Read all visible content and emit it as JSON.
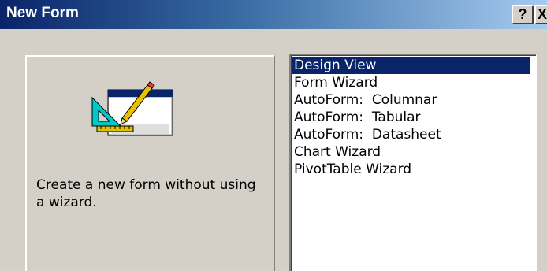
{
  "window": {
    "title": "New Form",
    "help_label": "?",
    "close_label": "X"
  },
  "preview": {
    "icon": "form-design-icon",
    "description": "Create a new form without using a wizard."
  },
  "list": {
    "items": [
      {
        "label": "Design View",
        "selected": true
      },
      {
        "label": "Form Wizard",
        "selected": false
      },
      {
        "label": "AutoForm:  Columnar",
        "selected": false
      },
      {
        "label": "AutoForm:  Tabular",
        "selected": false
      },
      {
        "label": "AutoForm:  Datasheet",
        "selected": false
      },
      {
        "label": "Chart Wizard",
        "selected": false
      },
      {
        "label": "PivotTable Wizard",
        "selected": false
      }
    ]
  },
  "colors": {
    "titlebar_start": "#0a246a",
    "titlebar_end": "#a6caf0",
    "selection": "#0a246a",
    "dialog_face": "#d4d0c8"
  }
}
